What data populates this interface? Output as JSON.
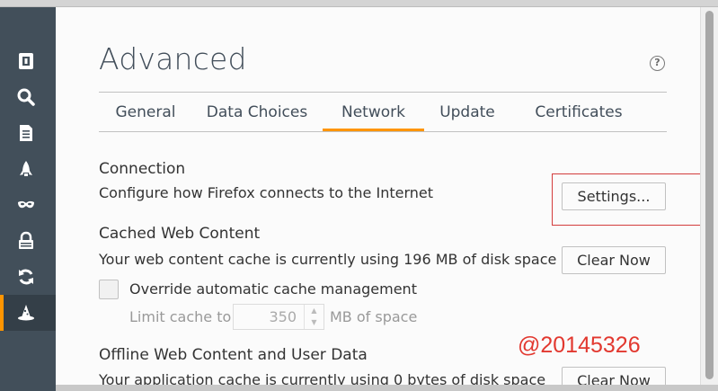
{
  "header": {
    "title": "Advanced",
    "help_label": "?"
  },
  "sidebar": {
    "items": [
      {
        "name": "General",
        "icon": "general-icon"
      },
      {
        "name": "Search",
        "icon": "search-icon"
      },
      {
        "name": "Content",
        "icon": "content-icon"
      },
      {
        "name": "Applications",
        "icon": "applications-icon"
      },
      {
        "name": "Privacy",
        "icon": "privacy-mask-icon"
      },
      {
        "name": "Security",
        "icon": "security-lock-icon"
      },
      {
        "name": "Sync",
        "icon": "sync-icon"
      },
      {
        "name": "Advanced",
        "icon": "advanced-wizard-hat-icon",
        "selected": true
      }
    ]
  },
  "tabs": [
    {
      "label": "General"
    },
    {
      "label": "Data Choices"
    },
    {
      "label": "Network",
      "selected": true
    },
    {
      "label": "Update"
    },
    {
      "label": "Certificates"
    }
  ],
  "connection": {
    "heading": "Connection",
    "description": "Configure how Firefox connects to the Internet",
    "settings_button": "Settings..."
  },
  "cache": {
    "heading": "Cached Web Content",
    "description": "Your web content cache is currently using 196 MB of disk space",
    "clear_button": "Clear Now",
    "override_label": "Override automatic cache management",
    "override_checked": false,
    "limit_label": "Limit cache to",
    "limit_value": "350",
    "limit_unit": "MB of space"
  },
  "offline": {
    "heading": "Offline Web Content and User Data",
    "description": "Your application cache is currently using 0 bytes of disk space",
    "clear_button": "Clear Now"
  },
  "watermark": "@20145326",
  "colors": {
    "accent": "#ff9500",
    "sidebar": "#424f5a",
    "highlight_box": "#d33c3c",
    "watermark": "#e2382f"
  }
}
